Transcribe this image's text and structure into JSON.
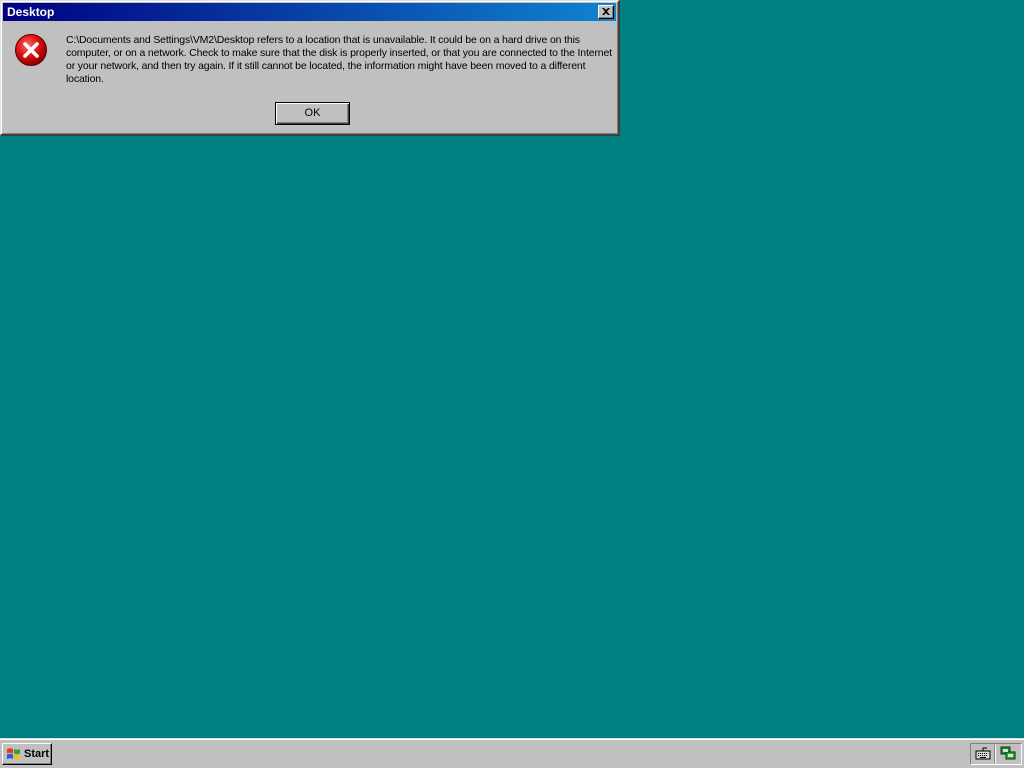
{
  "dialog": {
    "title": "Desktop",
    "icon": "error-icon",
    "message": "C:\\Documents and Settings\\VM2\\Desktop refers to a location that is unavailable. It could be on a hard drive on this computer, or on a network. Check to make sure that the disk is properly inserted, or that you are connected to the Internet or your network, and then try again. If it still cannot be located, the information might have been moved to a different location.",
    "ok_label": "OK"
  },
  "taskbar": {
    "start_label": "Start",
    "tray_icons": [
      "keyboard-icon",
      "network-icon"
    ]
  },
  "colors": {
    "desktop": "#008080",
    "title_bar_start": "#000080",
    "title_bar_end": "#1084d0",
    "face": "#c0c0c0",
    "error_red": "#cc0000"
  }
}
